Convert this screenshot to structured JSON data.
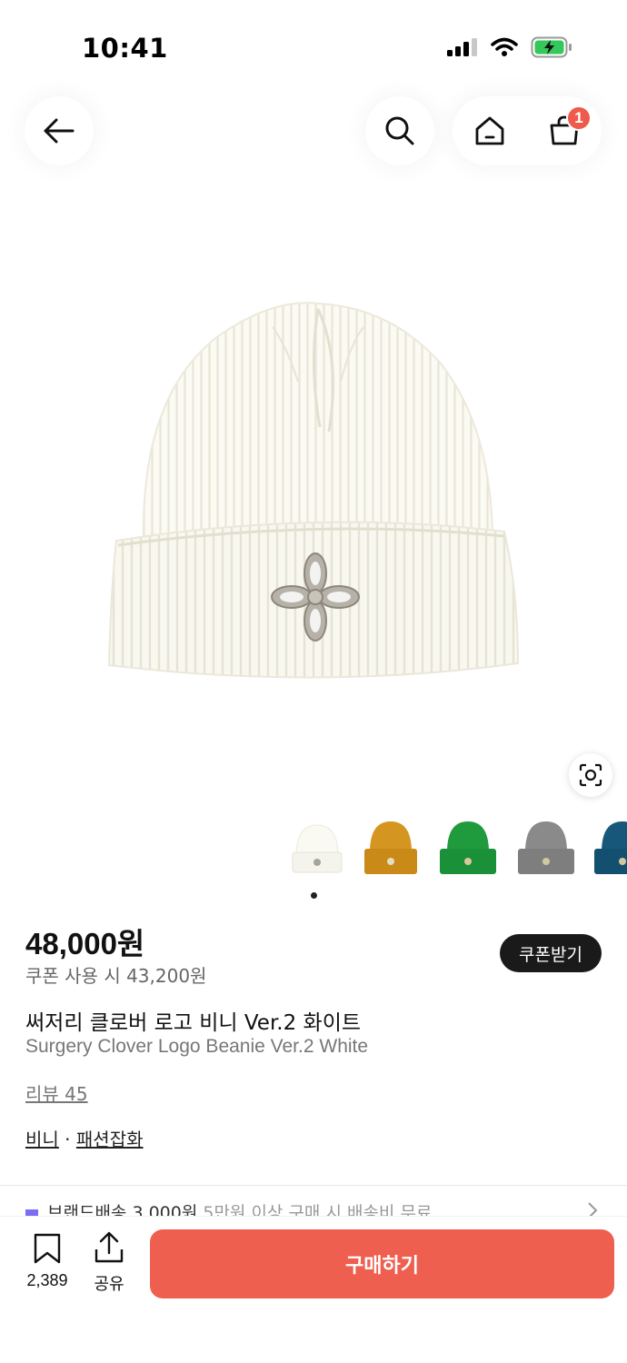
{
  "status": {
    "time": "10:41"
  },
  "header": {
    "cart_badge": "1"
  },
  "product": {
    "price": "48,000원",
    "coupon_price": "쿠폰 사용 시 43,200원",
    "coupon_button": "쿠폰받기",
    "name_ko": "써저리 클로버 로고 비니 Ver.2 화이트",
    "name_en": "Surgery Clover Logo Beanie Ver.2 White",
    "reviews": "리뷰 45",
    "category_1": "비니",
    "category_sep": " · ",
    "category_2": "패션잡화",
    "thumbnails": [
      "white",
      "mustard",
      "green",
      "gray",
      "navy"
    ]
  },
  "shipping": {
    "text": "브랜드배송 3,000원",
    "sub": " 5만원 이상 구매 시 배송비 무료"
  },
  "bottom": {
    "bookmark_count": "2,389",
    "share_label": "공유",
    "buy_label": "구매하기"
  },
  "colors": {
    "buy": "#ee5f50",
    "badge": "#ee5a4b",
    "coupon": "#1a1a1a"
  }
}
